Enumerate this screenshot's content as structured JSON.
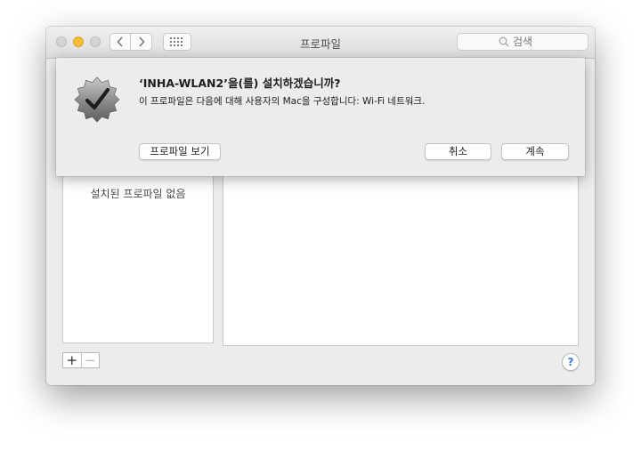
{
  "window": {
    "title": "프로파일",
    "search_placeholder": "검색"
  },
  "sidebar": {
    "empty_text": "설치된 프로파일 없음"
  },
  "footer": {
    "add_label": "+",
    "remove_label": "−",
    "help_label": "?"
  },
  "dialog": {
    "title": "‘INHA-WLAN2’을(를) 설치하겠습니까?",
    "message": "이 프로파일은 다음에 대해 사용자의 Mac을 구성합니다: Wi-Fi 네트워크.",
    "view_profile_label": "프로파일 보기",
    "cancel_label": "취소",
    "continue_label": "계속"
  },
  "colors": {
    "minimize_button": "#f5bb33",
    "help_accent": "#3f7be0",
    "window_background": "#ececec"
  },
  "icons": {
    "badge": "checkmark-badge-icon",
    "search": "search-icon",
    "back": "chevron-left-icon",
    "forward": "chevron-right-icon",
    "grid": "grid-icon"
  }
}
